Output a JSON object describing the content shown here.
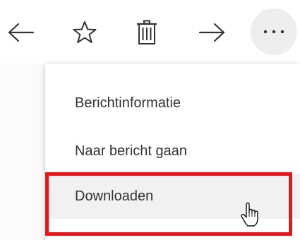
{
  "toolbar": {
    "back_icon": "arrow-left-icon",
    "favorite_icon": "star-outline-icon",
    "delete_icon": "trash-icon",
    "forward_icon": "arrow-right-icon",
    "more_icon": "ellipsis-icon"
  },
  "menu": {
    "items": [
      {
        "label": "Berichtinformatie"
      },
      {
        "label": "Naar bericht gaan"
      },
      {
        "label": "Downloaden"
      }
    ]
  },
  "colors": {
    "highlight_border": "#e8141a",
    "text": "#333333",
    "hover_background": "#f1f1f1",
    "more_button_background": "#eeeeee"
  },
  "cursor": "hand-pointer-icon"
}
